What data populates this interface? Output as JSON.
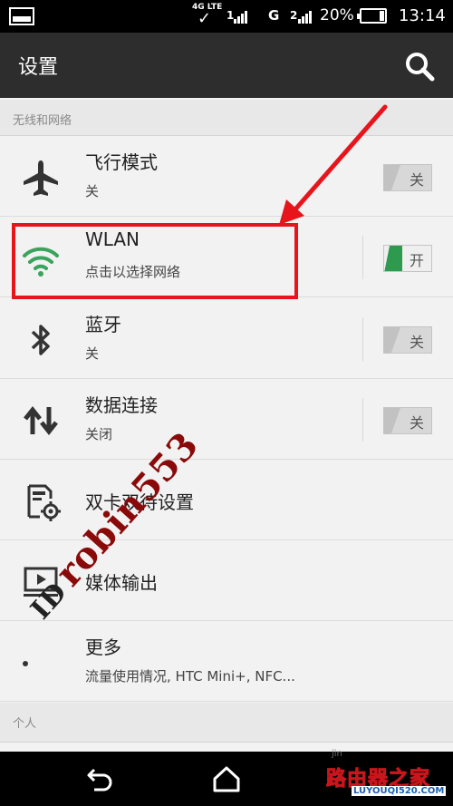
{
  "status_bar": {
    "network_type": "4G LTE",
    "carrier_g": "G",
    "battery_percent": "20%",
    "time": "13:14"
  },
  "header": {
    "title": "设置"
  },
  "sections": {
    "wireless": "无线和网络",
    "personal": "个人"
  },
  "rows": {
    "airplane": {
      "title": "飞行模式",
      "subtitle": "关",
      "toggle_label": "关",
      "toggle_on": false
    },
    "wlan": {
      "title": "WLAN",
      "subtitle": "点击以选择网络",
      "toggle_label": "开",
      "toggle_on": true
    },
    "bluetooth": {
      "title": "蓝牙",
      "subtitle": "关",
      "toggle_label": "关",
      "toggle_on": false
    },
    "mobile_data": {
      "title": "数据连接",
      "subtitle": "关闭",
      "toggle_label": "关",
      "toggle_on": false
    },
    "dual_sim": {
      "title": "双卡双待设置"
    },
    "media_output": {
      "title": "媒体输出"
    },
    "more": {
      "title": "更多",
      "subtitle": "流量使用情况, HTC Mini+, NFC..."
    }
  },
  "overlay": {
    "watermark": "robin553",
    "watermark_prefix": "ID",
    "corner_small": "jin",
    "corner_brand": "路由器之家",
    "corner_domain": "LUYOUQI520.COM"
  },
  "colors": {
    "highlight": "#e8141c",
    "toggle_on": "#2e9a4e",
    "header_bg": "#2d2d2d"
  },
  "icons": {
    "airplane": "airplane-icon",
    "wifi": "wifi-icon",
    "bluetooth": "bluetooth-icon",
    "data": "data-transfer-icon",
    "sim": "sim-settings-icon",
    "media": "media-output-icon",
    "more": "more-dot-icon",
    "search": "search-icon",
    "back": "back-icon",
    "home": "home-icon"
  }
}
